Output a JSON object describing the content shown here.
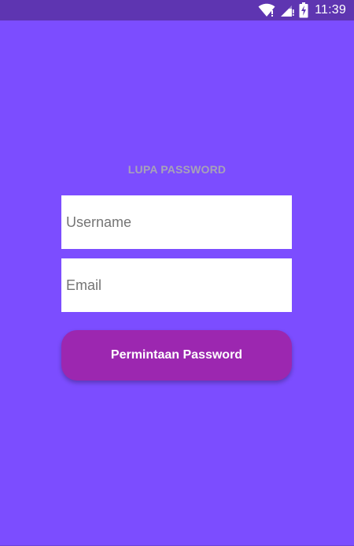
{
  "status_bar": {
    "time": "11:39",
    "icons": [
      "wifi-icon",
      "signal-icon",
      "battery-charging-icon"
    ]
  },
  "screen": {
    "title": "LUPA PASSWORD",
    "username_placeholder": "Username",
    "username_value": "",
    "email_placeholder": "Email",
    "email_value": "",
    "submit_label": "Permintaan Password"
  },
  "colors": {
    "background": "#7c4dff",
    "status_bar": "#5e35b1",
    "title_text": "#a7a2b8",
    "button": "#9c27b0",
    "button_text": "#ffffff",
    "field_background": "#ffffff"
  }
}
